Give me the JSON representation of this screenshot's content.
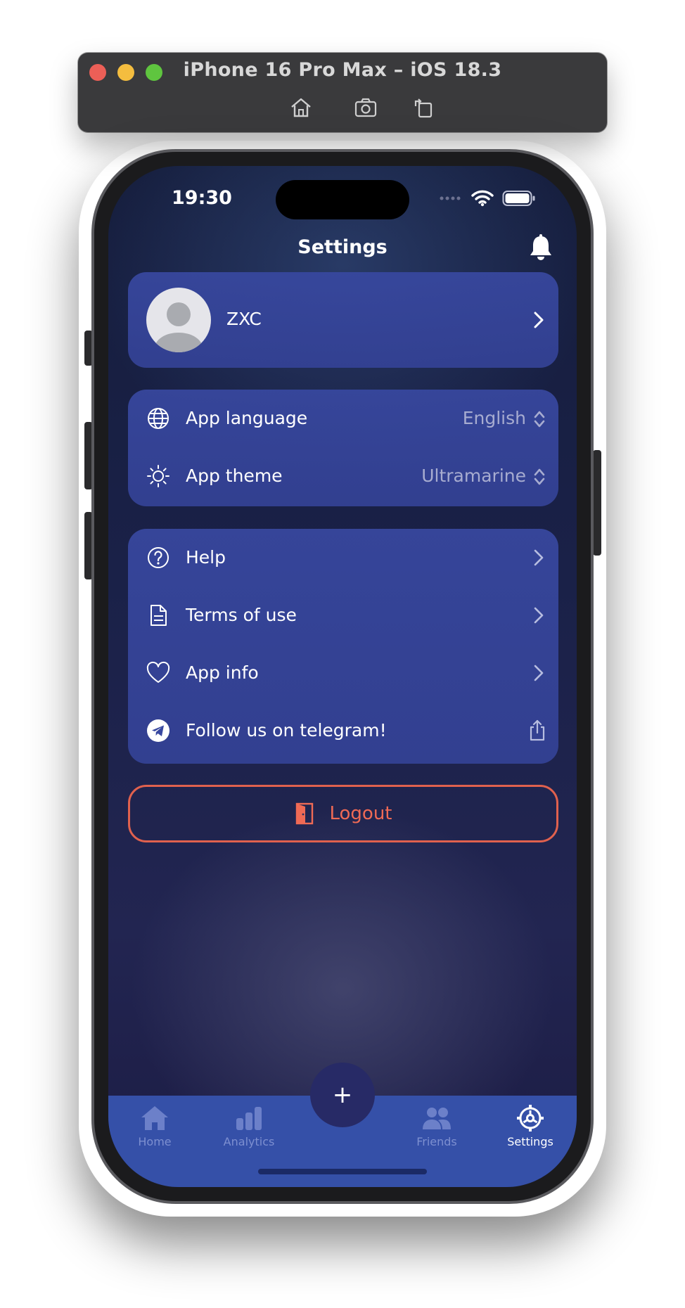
{
  "simulator": {
    "title": "iPhone 16 Pro Max – iOS 18.3",
    "buttons": [
      "home-icon",
      "screenshot-icon",
      "rotate-icon"
    ]
  },
  "status_bar": {
    "time": "19:30"
  },
  "header": {
    "title": "Settings"
  },
  "profile": {
    "name": "ZXC"
  },
  "preferences": [
    {
      "label": "App language",
      "value": "English",
      "icon": "globe-icon"
    },
    {
      "label": "App theme",
      "value": "Ultramarine",
      "icon": "sun-icon"
    }
  ],
  "links": [
    {
      "label": "Help",
      "icon": "help-icon"
    },
    {
      "label": "Terms of use",
      "icon": "document-icon"
    },
    {
      "label": "App info",
      "icon": "heart-icon"
    },
    {
      "label": "Follow us on telegram!",
      "icon": "telegram-icon"
    }
  ],
  "logout": {
    "label": "Logout"
  },
  "tabbar": {
    "items": [
      {
        "label": "Home",
        "icon": "home-icon"
      },
      {
        "label": "Analytics",
        "icon": "analytics-icon"
      },
      {
        "label": "Friends",
        "icon": "friends-icon"
      },
      {
        "label": "Settings",
        "icon": "gear-icon",
        "active": true
      }
    ],
    "fab": "+"
  },
  "colors": {
    "accent_card": "#3848a0",
    "tabbar": "#3550a8",
    "logout": "#e0614e"
  }
}
